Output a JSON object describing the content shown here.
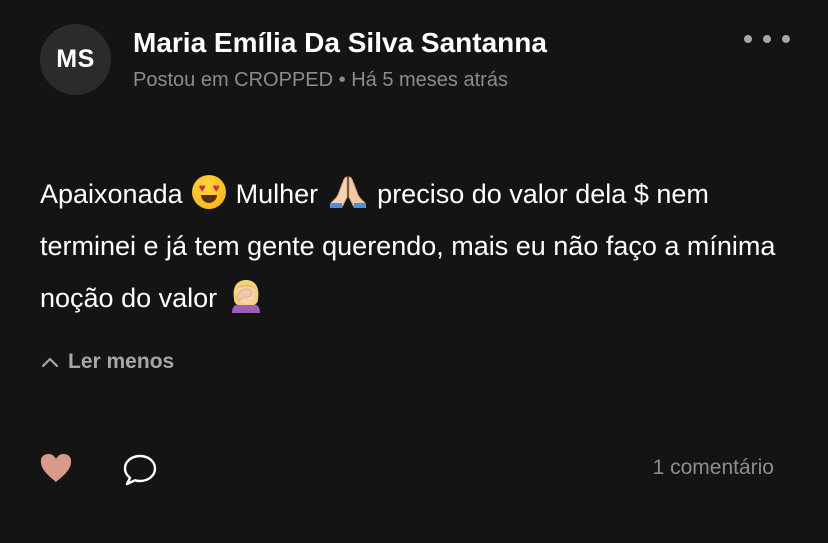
{
  "post": {
    "author": {
      "initials": "MS",
      "name": "Maria Emília Da Silva Santanna"
    },
    "meta": {
      "posted_in_prefix": "Postou em",
      "group": "CROPPED",
      "separator": "•",
      "time_ago": "Há 5 meses atrás"
    },
    "body": {
      "segment_1": "Apaixonada ",
      "emoji_1": "smiling-face-with-heart-eyes",
      "segment_2": " Mulher ",
      "emoji_2": "folded-hands",
      "segment_3": " preciso do valor dela $ nem terminei e já tem gente querendo, mais eu não faço a mínima noção do valor ",
      "emoji_3": "woman-facepalming"
    },
    "read_less_label": "Ler menos",
    "actions": {
      "like_icon": "heart-icon",
      "comment_icon": "speech-bubble-icon",
      "more_icon": "ellipsis-icon"
    },
    "comment_count_label": "1 comentário"
  },
  "colors": {
    "background": "#141414",
    "avatar_bg": "#2b2b2b",
    "muted_text": "#8c8c8c",
    "heart": "#d99a8a"
  }
}
